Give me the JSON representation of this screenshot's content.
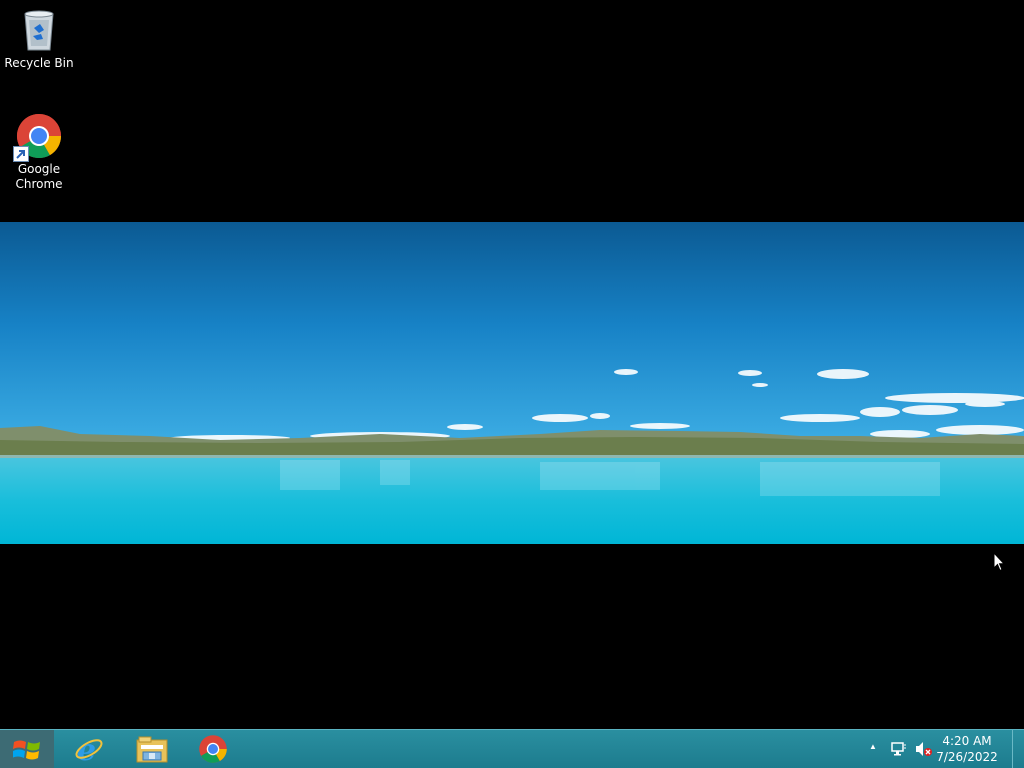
{
  "desktop": {
    "icons": [
      {
        "label": "Recycle Bin",
        "icon": "recycle-bin-icon"
      },
      {
        "label": "Google\nChrome",
        "icon": "chrome-icon"
      }
    ]
  },
  "taskbar": {
    "start": {
      "icon": "windows-logo-icon"
    },
    "pinned": [
      {
        "name": "Internet Explorer",
        "icon": "internet-explorer-icon"
      },
      {
        "name": "File Explorer",
        "icon": "file-explorer-icon"
      },
      {
        "name": "Google Chrome",
        "icon": "chrome-icon"
      }
    ],
    "tray": {
      "show_hidden": "▲",
      "network_icon": "network-icon",
      "volume_icon": "volume-muted-icon",
      "time": "4:20 AM",
      "date": "7/26/2022"
    }
  },
  "colors": {
    "taskbar": "#2288a0",
    "desktop_bg": "#000000",
    "chrome_red": "#db4437",
    "chrome_green": "#0f9d58",
    "chrome_yellow": "#f4b400",
    "chrome_blue": "#4285f4"
  }
}
